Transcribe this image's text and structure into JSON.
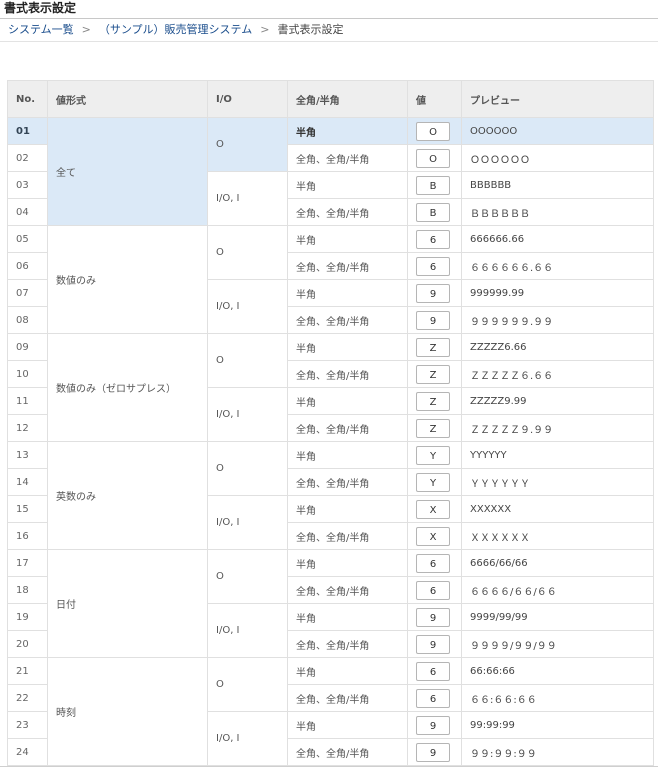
{
  "page": {
    "title": "書式表示設定"
  },
  "breadcrumb": {
    "items": [
      "システム一覧",
      "（サンプル）販売管理システム",
      "書式表示設定"
    ],
    "separator": ">"
  },
  "table": {
    "headers": [
      "No.",
      "値形式",
      "I/O",
      "全角/半角",
      "値",
      "プレビュー"
    ],
    "groups": [
      "全て",
      "数値のみ",
      "数値のみ（ゼロサプレス）",
      "英数のみ",
      "日付",
      "時刻"
    ],
    "io_labels": [
      "O",
      "I/O, I"
    ],
    "width_labels": [
      "半角",
      "全角、全角/半角"
    ],
    "rows": [
      {
        "no": "01",
        "value": "O",
        "preview": "OOOOOO"
      },
      {
        "no": "02",
        "value": "O",
        "preview": "ＯＯＯＯＯＯ"
      },
      {
        "no": "03",
        "value": "B",
        "preview": "BBBBBB"
      },
      {
        "no": "04",
        "value": "B",
        "preview": "ＢＢＢＢＢＢ"
      },
      {
        "no": "05",
        "value": "6",
        "preview": "666666.66"
      },
      {
        "no": "06",
        "value": "6",
        "preview": "６６６６６６.６６"
      },
      {
        "no": "07",
        "value": "9",
        "preview": "999999.99"
      },
      {
        "no": "08",
        "value": "9",
        "preview": "９９９９９９.９９"
      },
      {
        "no": "09",
        "value": "Z",
        "preview": "ZZZZZ6.66"
      },
      {
        "no": "10",
        "value": "Z",
        "preview": "ＺＺＺＺＺ６.６６"
      },
      {
        "no": "11",
        "value": "Z",
        "preview": "ZZZZZ9.99"
      },
      {
        "no": "12",
        "value": "Z",
        "preview": "ＺＺＺＺＺ９.９９"
      },
      {
        "no": "13",
        "value": "Y",
        "preview": "YYYYYY"
      },
      {
        "no": "14",
        "value": "Y",
        "preview": "ＹＹＹＹＹＹ"
      },
      {
        "no": "15",
        "value": "X",
        "preview": "XXXXXX"
      },
      {
        "no": "16",
        "value": "X",
        "preview": "ＸＸＸＸＸＸ"
      },
      {
        "no": "17",
        "value": "6",
        "preview": "6666/66/66"
      },
      {
        "no": "18",
        "value": "6",
        "preview": "６６６６/６６/６６"
      },
      {
        "no": "19",
        "value": "9",
        "preview": "9999/99/99"
      },
      {
        "no": "20",
        "value": "9",
        "preview": "９９９９/９９/９９"
      },
      {
        "no": "21",
        "value": "6",
        "preview": "66:66:66"
      },
      {
        "no": "22",
        "value": "6",
        "preview": "６６:６６:６６"
      },
      {
        "no": "23",
        "value": "9",
        "preview": "99:99:99"
      },
      {
        "no": "24",
        "value": "9",
        "preview": "９９:９９:９９"
      }
    ]
  },
  "colors": {
    "selected_row": "#dbe9f7",
    "header_bg": "#eeeeee",
    "link": "#1a4d8c"
  }
}
